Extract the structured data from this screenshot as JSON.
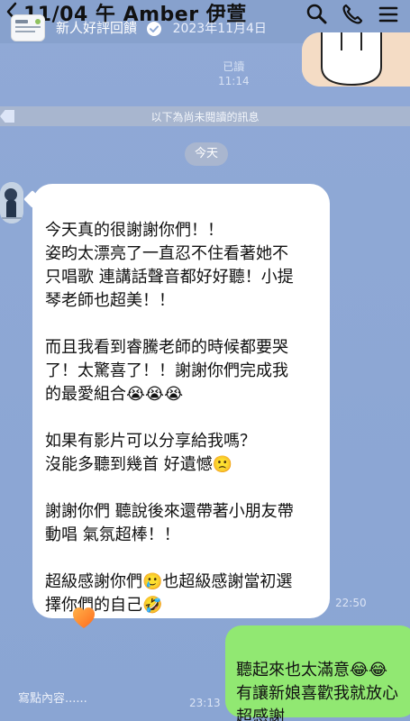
{
  "header": {
    "title": "11/04 午 Amber 伊萱",
    "subtitle": "新人好評回饋",
    "date": "2023年11月4日"
  },
  "top": {
    "read_label": "已讀",
    "read_time": "11:14",
    "sticker_marks": "!!"
  },
  "divider": {
    "unread_notice": "以下為尚未閱讀的訊息",
    "date_chip": "今天"
  },
  "incoming_message": {
    "text": "今天真的很謝謝你們！！\n姿昀太漂亮了一直忍不住看著她不\n只唱歌 連講話聲音都好好聽！小提\n琴老師也超美！！\n\n而且我看到睿騰老師的時候都要哭\n了！太驚喜了！！謝謝你們完成我\n的最愛組合😭😭😭\n\n如果有影片可以分享給我嗎？\n沒能多聽到幾首 好遺憾🙁\n\n謝謝你們 聽說後來還帶著小朋友帶\n動唱 氣氛超棒！！\n\n超級感謝你們🥲也超級感謝當初選\n擇你們的自己🤣",
    "time": "22:50",
    "reaction": "heart"
  },
  "outgoing_message": {
    "text": "聽起來也太滿意😂😂\n有讓新娘喜歡我就放心\n超感謝",
    "time": "23:13"
  },
  "input": {
    "placeholder": "寫點內容......"
  },
  "icons": {
    "back": "back-icon",
    "verified": "verified-icon",
    "search": "search-icon",
    "call": "phone-icon",
    "menu": "menu-icon",
    "reaction": "heart-icon"
  },
  "colors": {
    "chat_background": "#8ea9d6",
    "incoming_bubble": "#ffffff",
    "outgoing_bubble": "#91e872",
    "unread_banner": "#a8b6cf"
  }
}
